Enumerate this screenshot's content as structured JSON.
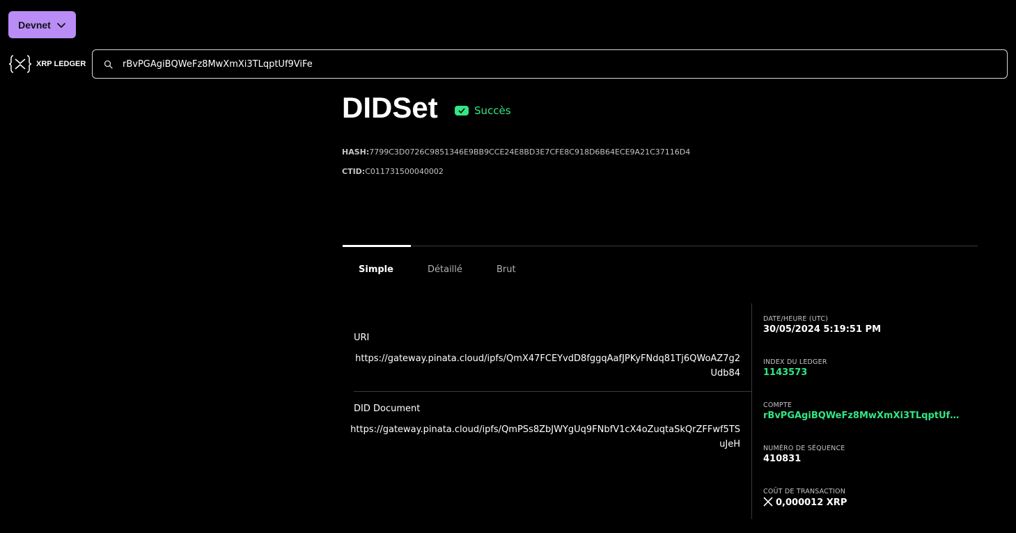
{
  "network": {
    "label": "Devnet",
    "icon": "chevron-down-icon"
  },
  "logo": {
    "text": "XRP LEDGER"
  },
  "search": {
    "value": "rBvPGAgiBQWeFz8MwXmXi3TLqptUf9ViFe",
    "icon": "search-icon"
  },
  "header": {
    "title": "DIDSet",
    "status": "Succès",
    "status_color": "#32e685",
    "hash_label": "HASH:",
    "hash_value": "7799C3D0726C9851346E9BB9CCE24E8BD3E7CFE8C918D6B64ECE9A21C37116D4",
    "ctid_label": "CTID:",
    "ctid_value": "C011731500040002"
  },
  "tabs": [
    {
      "label": "Simple",
      "active": true
    },
    {
      "label": "Détaillé",
      "active": false
    },
    {
      "label": "Brut",
      "active": false
    }
  ],
  "details": [
    {
      "label": "URI",
      "value": "https://gateway.pinata.cloud/ipfs/QmX47FCEYvdD8fggqAafJPKyFNdq81Tj6QWoAZ7g2Udb84"
    },
    {
      "label": "DID Document",
      "value": "https://gateway.pinata.cloud/ipfs/QmPSs8ZbJWYgUq9FNbfV1cX4oZuqtaSkQrZFFwf5TSuJeH"
    }
  ],
  "sidebar": {
    "datetime_label": "DATE/HEURE (UTC)",
    "datetime_value": "30/05/2024 5:19:51 PM",
    "ledger_label": "INDEX DU LEDGER",
    "ledger_value": "1143573",
    "account_label": "COMPTE",
    "account_value": "rBvPGAgiBQWeFz8MwXmXi3TLqptUf9ViFe",
    "sequence_label": "NUMÉRO DE SÉQUENCE",
    "sequence_value": "410831",
    "fee_label": "COÛT DE TRANSACTION",
    "fee_value": "0,000012 XRP",
    "fee_icon": "xrp-icon"
  }
}
